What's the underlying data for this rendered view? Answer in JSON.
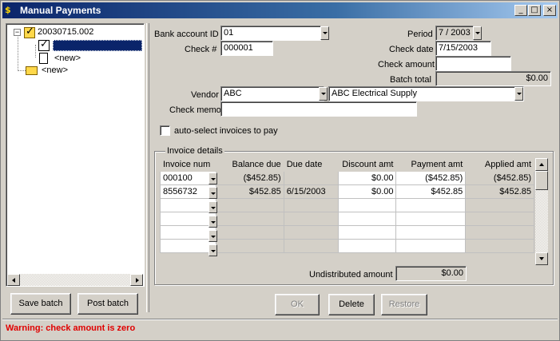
{
  "window": {
    "title": "Manual Payments",
    "title_icon": "dollar-icon"
  },
  "tree": {
    "root_label": "20030715.002",
    "items": [
      {
        "label": "",
        "selected": true
      },
      {
        "label": "<new>"
      }
    ],
    "root_new": "<new>"
  },
  "left_buttons": {
    "save": "Save batch",
    "post": "Post batch"
  },
  "form": {
    "bank_account_label": "Bank account ID",
    "bank_account_value": "01",
    "check_num_label": "Check #",
    "check_num_value": "000001",
    "period_label": "Period",
    "period_value": "7 / 2003",
    "check_date_label": "Check date",
    "check_date_value": "7/15/2003",
    "check_amount_label": "Check amount",
    "check_amount_value": "",
    "batch_total_label": "Batch total",
    "batch_total_value": "$0.00",
    "vendor_label": "Vendor",
    "vendor_id": "ABC",
    "vendor_name": "ABC Electrical Supply",
    "check_memo_label": "Check memo",
    "check_memo_value": "",
    "auto_select_label": "auto-select invoices to pay"
  },
  "invoice": {
    "group_title": "Invoice details",
    "headers": [
      "Invoice num",
      "Balance due",
      "Due date",
      "Discount amt",
      "Payment amt",
      "Applied amt"
    ],
    "rows": [
      [
        "000100",
        "($452.85)",
        "",
        "$0.00",
        "($452.85)",
        "($452.85)"
      ],
      [
        "8556732",
        "$452.85",
        "6/15/2003",
        "$0.00",
        "$452.85",
        "$452.85"
      ],
      [
        "",
        "",
        "",
        "",
        "",
        ""
      ],
      [
        "",
        "",
        "",
        "",
        "",
        ""
      ],
      [
        "",
        "",
        "",
        "",
        "",
        ""
      ],
      [
        "",
        "",
        "",
        "",
        "",
        ""
      ]
    ],
    "undistributed_label": "Undistributed amount",
    "undistributed_value": "$0.00"
  },
  "bottom_buttons": {
    "ok": "OK",
    "delete": "Delete",
    "restore": "Restore"
  },
  "status": {
    "warning": "Warning: check amount is zero"
  }
}
